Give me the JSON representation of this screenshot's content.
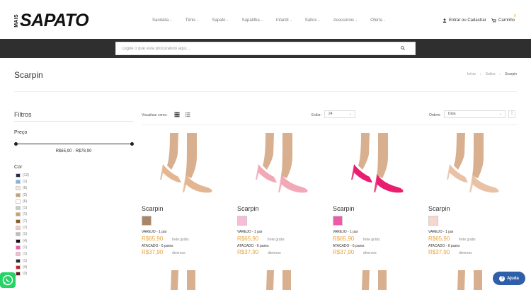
{
  "header": {
    "logo_small": "MAIS",
    "logo_word": "SAPATO",
    "nav": [
      "Sandália",
      "Tênis",
      "Sapato",
      "Sapatilha",
      "Infantil",
      "Saltos",
      "Acessórios",
      "Oferta"
    ],
    "account_label": "Entrar ou Cadastrar",
    "cart_label": "Carrinho",
    "cart_count": "0"
  },
  "search": {
    "placeholder": "Digite o que está procurando aqui..."
  },
  "page": {
    "title": "Scarpin",
    "breadcrumb": [
      "Início",
      "Saltos",
      "Scarpin"
    ]
  },
  "filters": {
    "title": "Filtros",
    "price_label": "Preço",
    "price_range": "R$65,90 - R$78,90",
    "price_range_fraction": [
      0,
      1
    ],
    "color_label": "Cor",
    "colors": [
      {
        "color": "#1f2a4d",
        "count": "(12)"
      },
      {
        "color": "#7fb3e6",
        "count": "(1)"
      },
      {
        "color": "#f2ead8",
        "count": "(6)"
      },
      {
        "color": "#c8a06f",
        "count": "(2)"
      },
      {
        "color": "#ffffff",
        "count": "(6)"
      },
      {
        "color": "#c9c9c9",
        "count": "(1)"
      },
      {
        "color": "#d4a34a",
        "count": "(1)"
      },
      {
        "color": "#8a5a2b",
        "count": "(7)"
      },
      {
        "color": "#f7c6c0",
        "count": "(7)"
      },
      {
        "color": "#bdbdbd",
        "count": "(1)"
      },
      {
        "color": "#111111",
        "count": "(4)"
      },
      {
        "color": "#f25aa6",
        "count": "(1)"
      },
      {
        "color": "#f5b8cf",
        "count": "(1)"
      },
      {
        "color": "#2a2a2a",
        "count": "(1)"
      },
      {
        "color": "#c0242b",
        "count": "(4)"
      },
      {
        "color": "#6b1320",
        "count": "(3)"
      }
    ]
  },
  "toolbar": {
    "view_label": "Visualizar como:",
    "show_label": "Exibir:",
    "show_value": "24",
    "order_label": "Ordem:",
    "order_value": "Data"
  },
  "products": [
    {
      "name": "Scarpin",
      "shoe_color": "#e3b590",
      "swatch": "#a88666",
      "retail_label": "VAREJO - 1 par",
      "retail_price": "R$65,90",
      "retail_note": "frete grátis",
      "wholesale_label": "ATACADO - 6 pares",
      "wholesale_price": "R$37,90",
      "wholesale_note": "diversos"
    },
    {
      "name": "Scarpin",
      "shoe_color": "#f2a8b6",
      "swatch": "#f7bcd6",
      "retail_label": "VAREJO - 1 par",
      "retail_price": "R$65,90",
      "retail_note": "frete grátis",
      "wholesale_label": "ATACADO - 6 pares",
      "wholesale_price": "R$37,90",
      "wholesale_note": "diversos"
    },
    {
      "name": "Scarpin",
      "shoe_color": "#e81f6e",
      "swatch": "#ef5aa8",
      "retail_label": "VAREJO - 1 par",
      "retail_price": "R$65,90",
      "retail_note": "frete grátis",
      "wholesale_label": "ATACADO - 6 pares",
      "wholesale_price": "R$37,90",
      "wholesale_note": "diversos"
    },
    {
      "name": "Scarpin",
      "shoe_color": "#e9c2a6",
      "swatch": "#f8d6cf",
      "retail_label": "VAREJO - 1 par",
      "retail_price": "R$65,90",
      "retail_note": "frete grátis",
      "wholesale_label": "ATACADO - 6 pares",
      "wholesale_price": "R$37,90",
      "wholesale_note": "diversos"
    }
  ],
  "floating": {
    "help_label": "Ajuda",
    "whatsapp_color": "#25d366",
    "help_color": "#2e5fa8"
  }
}
